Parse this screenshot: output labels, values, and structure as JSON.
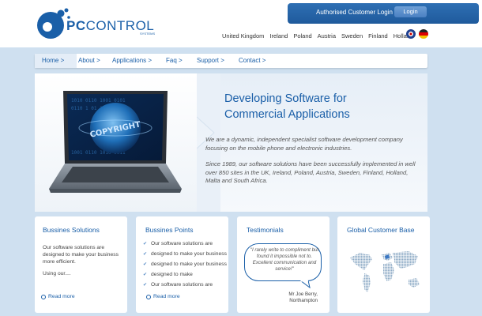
{
  "logo": {
    "pc": "PC",
    "control": "CONTROL",
    "sub": "SYSTEMS"
  },
  "login": {
    "label": "Authorised Customer Login",
    "button": "Login"
  },
  "countries": [
    "United Kingdom",
    "Ireland",
    "Poland",
    "Austria",
    "Sweden",
    "Finland",
    "Holland"
  ],
  "nav": [
    "Home >",
    "About >",
    "Applications >",
    "Faq >",
    "Support >",
    "Contact >"
  ],
  "hero": {
    "title_line1": "Developing Software for",
    "title_line2": "Commercial Applications",
    "p1": "We are a dynamic, independent specialist software development company focusing on the mobile phone and electronic industries.",
    "p2": "Since 1989, our software solutions have been successfully implemented in well over 850 sites in the UK, Ireland, Poland, Austria, Sweden, Finland, Holland, Malta and South Africa.",
    "screen_text": "COPYRIGHT"
  },
  "cards": {
    "solutions": {
      "title": "Bussines Solutions",
      "text1": "Our software solutions are designed to make your business more efficient.",
      "text2": "Using our....",
      "readmore": "Read more"
    },
    "points": {
      "title": "Bussines Points",
      "items": [
        "Our software solutions are",
        "designed to make your business",
        "designed to make your business",
        "designed to make",
        "Our software solutions are"
      ],
      "readmore": "Read more"
    },
    "testimonials": {
      "title": "Testimonials",
      "quote": "\"I rarely write to compliment but found it impossible not to. Excellent communication and service!\"",
      "author1": "Mr Joe Berry,",
      "author2": "Northampton"
    },
    "global": {
      "title": "Global Customer Base"
    }
  },
  "colors": {
    "brand": "#1a5fa8",
    "background": "#cfe0f0"
  }
}
